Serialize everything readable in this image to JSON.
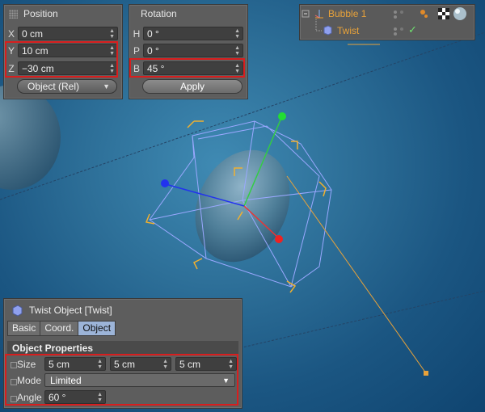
{
  "position": {
    "title": "Position",
    "rows": [
      {
        "axis": "X",
        "value": "0 cm"
      },
      {
        "axis": "Y",
        "value": "10 cm"
      },
      {
        "axis": "Z",
        "value": "−30 cm"
      }
    ],
    "mode_dropdown": "Object (Rel)"
  },
  "rotation": {
    "title": "Rotation",
    "rows": [
      {
        "axis": "H",
        "value": "0 °"
      },
      {
        "axis": "P",
        "value": "0 °"
      },
      {
        "axis": "B",
        "value": "45 °"
      }
    ],
    "apply_label": "Apply"
  },
  "object_manager": {
    "items": [
      {
        "name": "Bubble 1",
        "color": "#e8a23a"
      },
      {
        "name": "Twist",
        "color": "#e8a23a"
      }
    ]
  },
  "attributes": {
    "title": "Twist Object [Twist]",
    "tabs": [
      "Basic",
      "Coord.",
      "Object"
    ],
    "active_tab": "Object",
    "section_title": "Object Properties",
    "size_label": "Size",
    "size_values": [
      "5 cm",
      "5 cm",
      "5 cm"
    ],
    "mode_label": "Mode",
    "mode_value": "Limited",
    "angle_label": "Angle",
    "angle_value": "60 °"
  },
  "colors": {
    "highlight_box": "#d81e1e",
    "viewport": "#2d6f98",
    "selection_handles": "#f0b030",
    "deformer_cage": "#8f9ff0"
  }
}
